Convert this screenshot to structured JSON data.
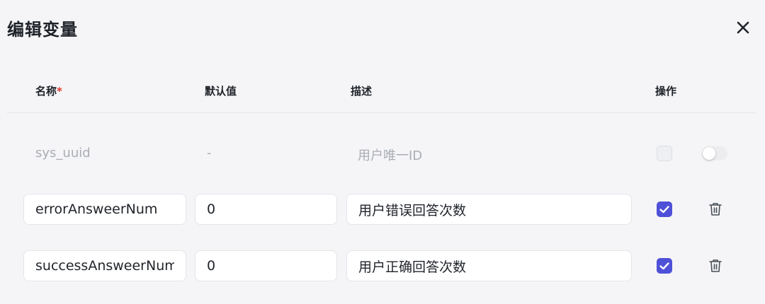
{
  "dialog": {
    "title": "编辑变量",
    "close_icon": "close-icon"
  },
  "table": {
    "headers": {
      "name": "名称",
      "name_required_mark": "*",
      "default": "默认值",
      "description": "描述",
      "actions": "操作"
    },
    "system_row": {
      "name": "sys_uuid",
      "default": "-",
      "description": "用户唯一ID",
      "checkbox_checked": false,
      "checkbox_disabled": true,
      "toggle_on": false
    },
    "rows": [
      {
        "name": "errorAnsweerNum",
        "default": "0",
        "description": "用户错误回答次数",
        "checked": true,
        "delete_icon": "trash-icon"
      },
      {
        "name": "successAnsweerNum",
        "default": "0",
        "description": "用户正确回答次数",
        "checked": true,
        "delete_icon": "trash-icon"
      }
    ]
  },
  "colors": {
    "accent": "#4f50d8",
    "required": "#e0382e",
    "muted_text": "#a9adb4",
    "background": "#f5f5f7"
  }
}
